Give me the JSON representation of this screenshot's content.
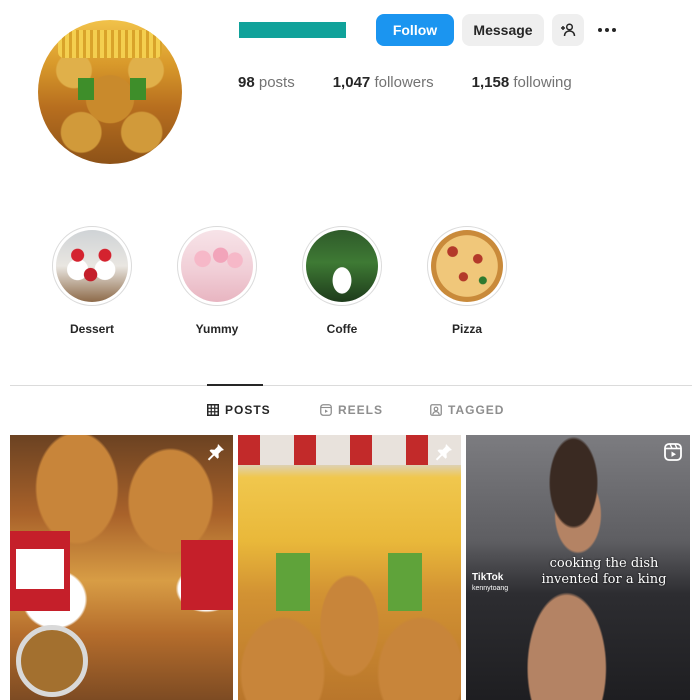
{
  "profile": {
    "username_color": "#10a29a",
    "avatar_icon": "profile-avatar-fast-food"
  },
  "header": {
    "follow_label": "Follow",
    "message_label": "Message",
    "add_user_icon": "add-user-icon",
    "more_icon": "more-options-icon"
  },
  "stats": {
    "posts_count": "98",
    "posts_label": "posts",
    "followers_count": "1,047",
    "followers_label": "followers",
    "following_count": "1,158",
    "following_label": "following"
  },
  "highlights": [
    {
      "label": "Dessert"
    },
    {
      "label": "Yummy"
    },
    {
      "label": "Coffe"
    },
    {
      "label": "Pizza"
    }
  ],
  "tabs": [
    {
      "label": "POSTS",
      "icon": "grid-icon",
      "active": true
    },
    {
      "label": "REELS",
      "icon": "reels-icon",
      "active": false
    },
    {
      "label": "TAGGED",
      "icon": "tagged-icon",
      "active": false
    }
  ],
  "posts": [
    {
      "badge_icon": "pin-icon"
    },
    {
      "badge_icon": "pin-icon"
    },
    {
      "badge_icon": "reel-icon",
      "caption": "cooking the dish invented for a king",
      "watermark": "TikTok",
      "watermark_handle": "kennytoang"
    }
  ],
  "colors": {
    "accent": "#1b95f0",
    "text": "#262626",
    "muted": "#737373",
    "divider": "#dbdbdb"
  }
}
